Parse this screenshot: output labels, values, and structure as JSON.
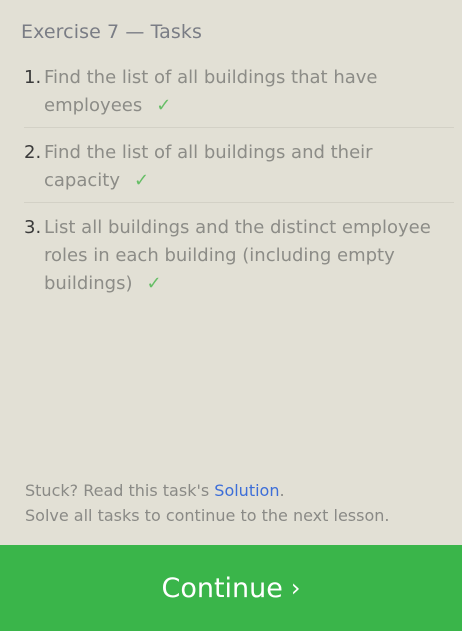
{
  "header": {
    "title": "Exercise 7 — Tasks"
  },
  "tasks": [
    {
      "number": "1.",
      "text": "Find the list of all buildings that have employees",
      "check": "✓"
    },
    {
      "number": "2.",
      "text": "Find the list of all buildings and their capacity",
      "check": "✓"
    },
    {
      "number": "3.",
      "text": "List all buildings and the distinct employee roles in each building (including empty buildings)",
      "check": "✓"
    }
  ],
  "footer": {
    "stuck_prefix": "Stuck? Read this task's ",
    "solution_link": "Solution",
    "stuck_suffix": ".",
    "hint": "Solve all tasks to continue to the next lesson."
  },
  "continue_button": {
    "label": "Continue",
    "chevron": "›"
  },
  "colors": {
    "background": "#e2e0d5",
    "check": "#66be66",
    "link": "#3d6ed8",
    "button": "#3ab54a"
  },
  "icons": {
    "check": "checkmark-icon",
    "chevron": "chevron-right-icon"
  }
}
